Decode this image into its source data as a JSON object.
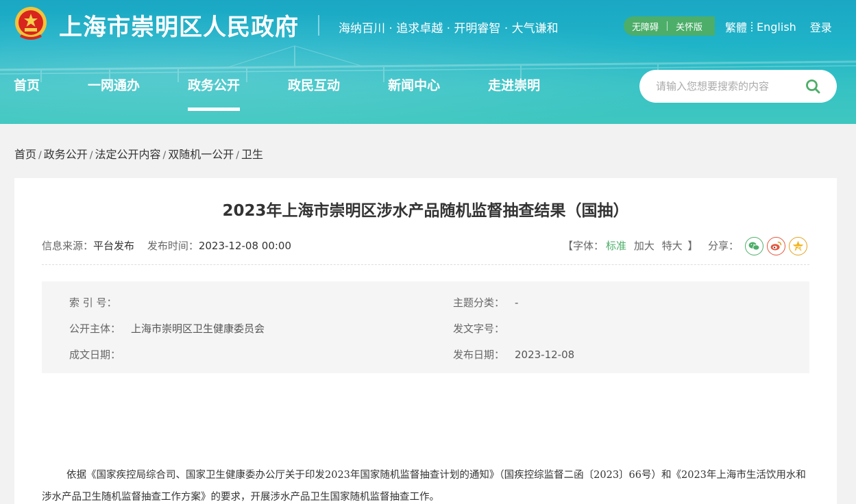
{
  "header": {
    "site_title": "上海市崇明区人民政府",
    "slogan": "海纳百川 · 追求卓越 · 开明睿智 · 大气谦和",
    "access": {
      "accessible": "无障碍",
      "elderly": "关怀版"
    },
    "links": {
      "traditional": "繁體",
      "english": "English",
      "login": "登录"
    },
    "nav": [
      {
        "label": "首页"
      },
      {
        "label": "一网通办"
      },
      {
        "label": "政务公开"
      },
      {
        "label": "政民互动"
      },
      {
        "label": "新闻中心"
      },
      {
        "label": "走进崇明"
      }
    ],
    "search": {
      "placeholder": "请输入您想要搜索的内容"
    },
    "colors": {
      "banner": "#1fb3c8",
      "accent_green": "#4cae69"
    }
  },
  "breadcrumb": [
    "首页",
    "政务公开",
    "法定公开内容",
    "双随机一公开",
    "卫生"
  ],
  "article": {
    "title": "2023年上海市崇明区涉水产品随机监督抽查结果（国抽）",
    "source_label": "信息来源：",
    "source_value": "平台发布",
    "time_label": "发布时间：",
    "time_value": "2023-12-08 00:00",
    "font_open": "【字体：",
    "font_standard": "标准",
    "font_large": "加大",
    "font_xlarge": "特大",
    "font_close": "】",
    "share_label": "分享：",
    "info": {
      "index_label": "索 引 号：",
      "index_value": "",
      "topic_label": "主题分类：",
      "topic_value": "-",
      "publisher_label": "公开主体：",
      "publisher_value": "上海市崇明区卫生健康委员会",
      "doc_no_label": "发文字号：",
      "doc_no_value": "",
      "written_label": "成文日期：",
      "written_value": "",
      "publish_label": "发布日期：",
      "publish_value": "2023-12-08"
    },
    "body": "依据《国家疾控局综合司、国家卫生健康委办公厅关于印发2023年国家随机监督抽查计划的通知》（国疾控综监督二函〔2023〕66号）和《2023年上海市生活饮用水和涉水产品卫生随机监督抽查工作方案》的要求，开展涉水产品卫生国家随机监督抽查工作。"
  }
}
